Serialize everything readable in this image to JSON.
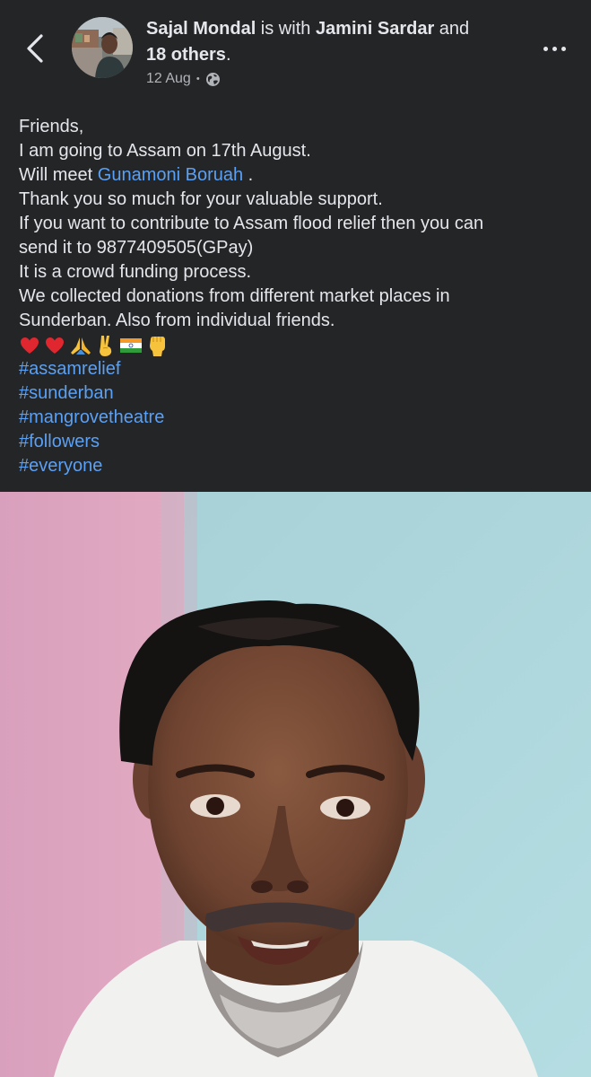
{
  "header": {
    "author": "Sajal Mondal",
    "with_text": " is with ",
    "tagged_person": "Jamini Sardar",
    "and_text": " and ",
    "others": "18 others",
    "period": ".",
    "date": "12 Aug",
    "dot": "•",
    "privacy_icon": "globe-icon",
    "back_icon": "chevron-left-icon",
    "more_icon": "more-horizontal-icon"
  },
  "post": {
    "line1": "Friends,",
    "line2": "I am going to Assam on 17th August.",
    "line3_prefix": "Will meet ",
    "line3_mention": "Gunamoni Boruah",
    "line3_suffix": " .",
    "line4": "Thank you so much for your valuable support.",
    "line5": "If you want to contribute to Assam flood relief then you can",
    "line6": "send it to 9877409505(GPay)",
    "line7": "It is a crowd funding process.",
    "line8": "We collected donations from different market places in",
    "line9": "Sunderban. Also from individual friends.",
    "emojis": [
      "red-heart-emoji",
      "red-heart-emoji",
      "folded-hands-emoji",
      "victory-hand-emoji",
      "india-flag-emoji",
      "raised-fist-emoji"
    ],
    "hashtags": [
      "#assamrelief",
      "#sunderban",
      "#mangrovetheatre",
      "#followers",
      "#everyone"
    ]
  },
  "media": {
    "type": "video-thumbnail"
  },
  "colors": {
    "background": "#242526",
    "text": "#e4e6eb",
    "secondary_text": "#b0b3b8",
    "link": "#5aa0f5"
  }
}
